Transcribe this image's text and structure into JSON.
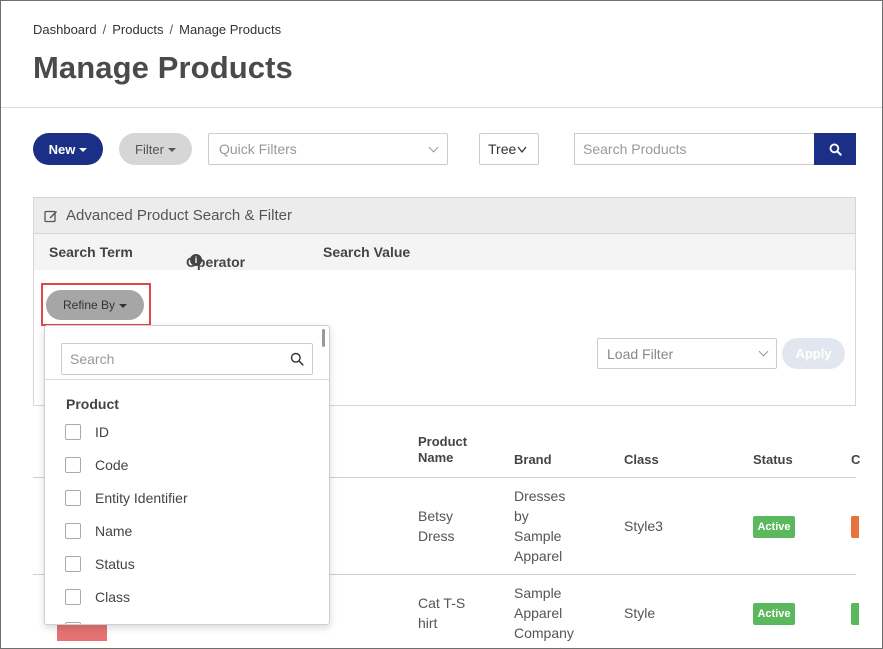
{
  "breadcrumb": {
    "items": [
      "Dashboard",
      "Products",
      "Manage Products"
    ],
    "separator": "/"
  },
  "page_title": "Manage Products",
  "toolbar": {
    "new_label": "New",
    "filter_label": "Filter",
    "quick_filters_placeholder": "Quick Filters",
    "view_select_value": "Tree",
    "search_placeholder": "Search Products",
    "accent_color": "#1c2f86"
  },
  "advanced": {
    "title": "Advanced Product Search & Filter",
    "columns": {
      "search_term": "Search Term",
      "operator": "Operator",
      "search_value": "Search Value"
    },
    "refine_label": "Refine By",
    "load_filter_placeholder": "Load Filter",
    "apply_label": "Apply"
  },
  "refine_dropdown": {
    "search_placeholder": "Search",
    "group_label": "Product",
    "items": [
      "ID",
      "Code",
      "Entity Identifier",
      "Name",
      "Status",
      "Class"
    ]
  },
  "table": {
    "headers": {
      "product_name": [
        "Product",
        "Name"
      ],
      "brand": "Brand",
      "class": "Class",
      "status": "Status",
      "next_col_initial": "C"
    },
    "rows": [
      {
        "product_name": [
          "Betsy",
          "Dress"
        ],
        "brand": [
          "Dresses",
          "by",
          "Sample",
          "Apparel"
        ],
        "class": "Style3",
        "status": "Active"
      },
      {
        "product_name": [
          "Cat T-S",
          "hirt"
        ],
        "brand": [
          "Sample",
          "Apparel",
          "Company"
        ],
        "class": "Style",
        "status": "Active"
      }
    ],
    "status_color": "#5cb85c"
  }
}
